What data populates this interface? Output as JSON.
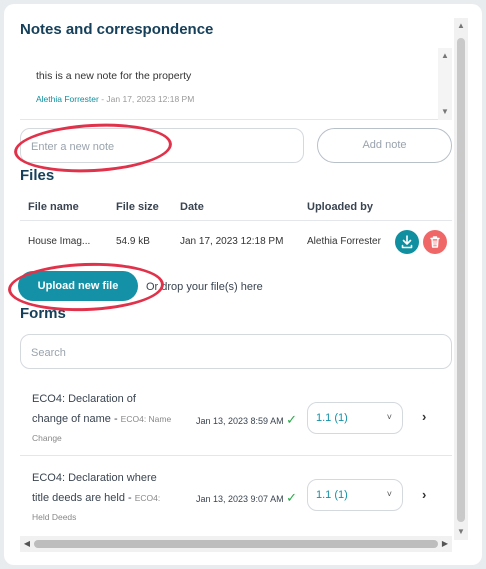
{
  "notes": {
    "title": "Notes and correspondence",
    "items": [
      {
        "text": "this is a new note for the property",
        "author": "Alethia Forrester",
        "date": "- Jan 17, 2023 12:18 PM"
      }
    ],
    "input_placeholder": "Enter a new note",
    "add_label": "Add note"
  },
  "files": {
    "title": "Files",
    "headers": [
      "File name",
      "File size",
      "Date",
      "Uploaded by"
    ],
    "rows": [
      {
        "name": "House Imag...",
        "size": "54.9 kB",
        "date": "Jan 17, 2023 12:18 PM",
        "uploaded_by": "Alethia Forrester"
      }
    ],
    "upload_label": "Upload new file",
    "drop_text": "Or drop your file(s) here"
  },
  "forms": {
    "title": "Forms",
    "search_placeholder": "Search",
    "rows": [
      {
        "title_line1": "ECO4: Declaration of",
        "title_line2": "change of name",
        "desc1": "ECO4: Name",
        "desc2": "Change",
        "date": "Jan 13, 2023 8:59 AM",
        "version": "1.1 (1)"
      },
      {
        "title_line1": "ECO4: Declaration where",
        "title_line2": "title deeds are held",
        "desc1": "ECO4:",
        "desc2": "Held Deeds",
        "date": "Jan 13, 2023 9:07 AM",
        "version": "1.1 (1)"
      }
    ]
  },
  "colors": {
    "accent": "#1491a6",
    "danger": "#f06767",
    "heading": "#16405a",
    "annotation": "#e0324a"
  },
  "icons": {
    "download": "download-icon",
    "delete": "trash-icon",
    "check": "check-icon",
    "chevron": "chevron-down-icon",
    "arrow": "chevron-right-icon"
  }
}
